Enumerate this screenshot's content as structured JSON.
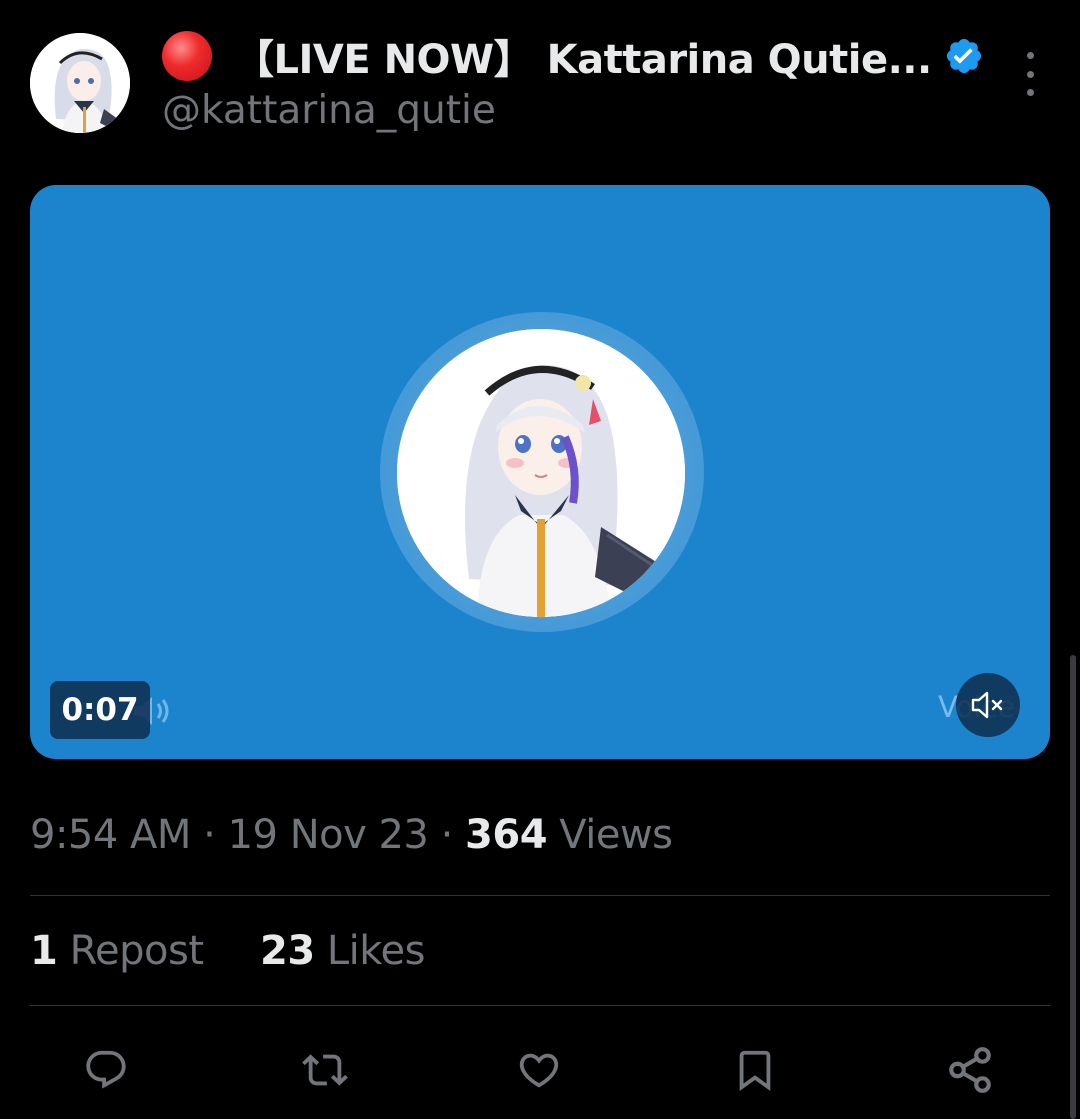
{
  "author": {
    "display_name": "【LIVE NOW】 Kattarina Qutie...",
    "handle": "@kattarina_qutie",
    "verified": true,
    "live_indicator": "red-circle-icon",
    "verified_color": "#1d9bf0"
  },
  "media": {
    "background_color": "#1c84cc",
    "elapsed_time": "0:07",
    "overlay_caption": "Voice",
    "audio_state": "muted"
  },
  "meta": {
    "time": "9:54 AM",
    "separator": "·",
    "date": "19 Nov 23",
    "views_count": "364",
    "views_label": "Views"
  },
  "stats": {
    "reposts_count": "1",
    "reposts_label": "Repost",
    "likes_count": "23",
    "likes_label": "Likes"
  },
  "actions": [
    "reply-icon",
    "repost-icon",
    "like-icon",
    "bookmark-icon",
    "share-icon"
  ],
  "colors": {
    "background": "#000000",
    "text_primary": "#e7e9ea",
    "text_secondary": "#71767b",
    "divider": "#2f3336"
  }
}
